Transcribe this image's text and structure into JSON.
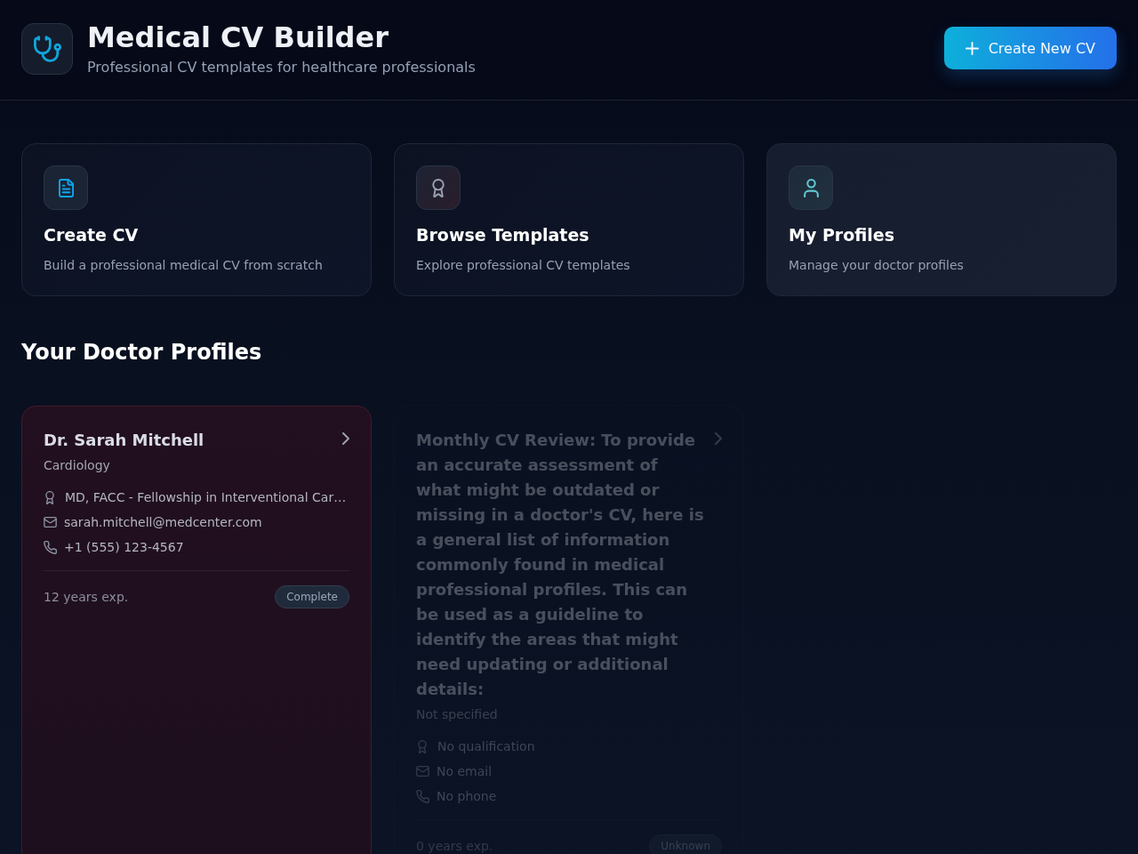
{
  "header": {
    "title": "Medical CV Builder",
    "subtitle": "Professional CV templates for healthcare professionals",
    "button": "Create New CV"
  },
  "actions": [
    {
      "title": "Create CV",
      "description": "Build a professional medical CV from scratch"
    },
    {
      "title": "Browse Templates",
      "description": "Explore professional CV templates"
    },
    {
      "title": "My Profiles",
      "description": "Manage your doctor profiles"
    }
  ],
  "profiles_heading": "Your Doctor Profiles",
  "profiles": [
    {
      "name": "Dr. Sarah Mitchell",
      "specialty": "Cardiology",
      "qualification": "MD, FACC - Fellowship in Interventional Car…",
      "email": "sarah.mitchell@medcenter.com",
      "phone": "+1 (555) 123-4567",
      "experience": "12 years exp.",
      "status": "Complete",
      "selected": true,
      "disabled": false
    },
    {
      "name": "Monthly CV Review: To provide an accurate assessment of what might be outdated or missing in a doctor's CV, here is a general list of information commonly found in medical professional profiles. This can be used as a guideline to identify the areas that might need updating or additional details:",
      "specialty": "Not specified",
      "qualification": "No qualification",
      "email": "No email",
      "phone": "No phone",
      "experience": "0 years exp.",
      "status": "Unknown",
      "selected": false,
      "disabled": true
    }
  ]
}
